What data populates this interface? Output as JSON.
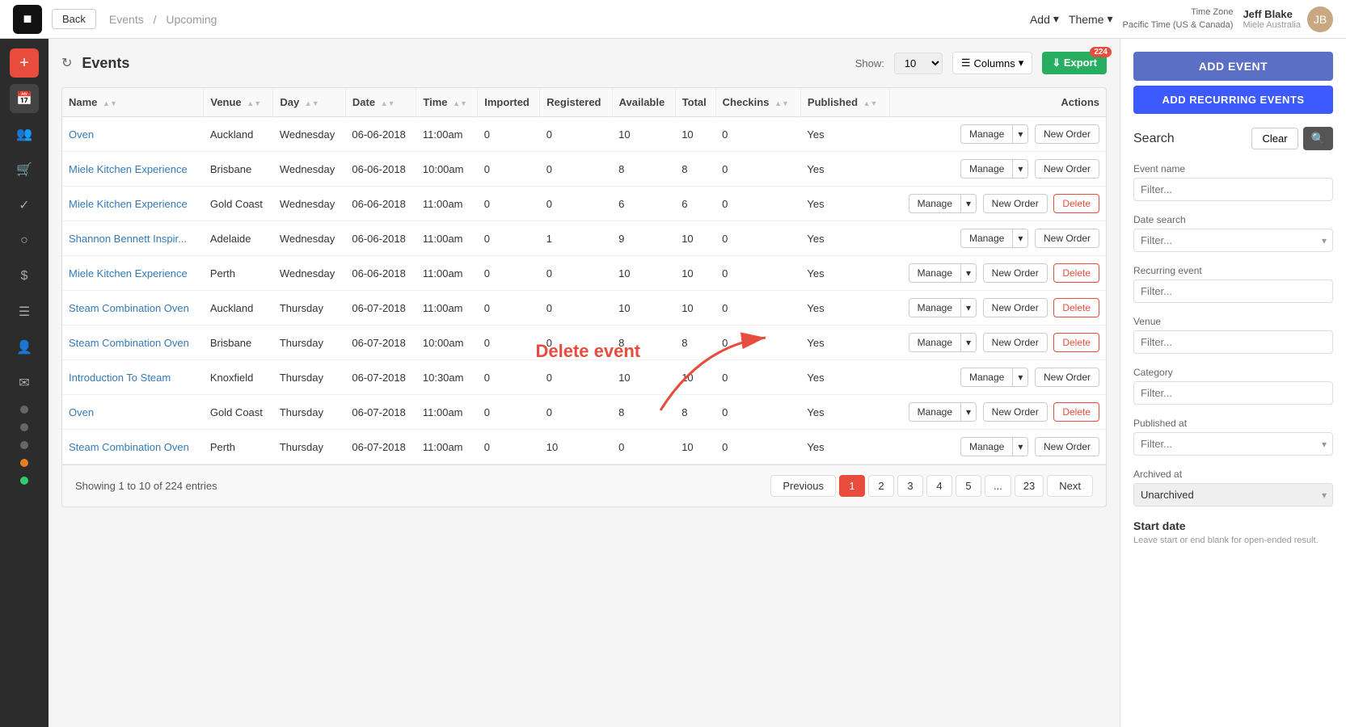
{
  "topnav": {
    "back_label": "Back",
    "breadcrumb_events": "Events",
    "breadcrumb_sep": "/",
    "breadcrumb_upcoming": "Upcoming",
    "add_label": "Add",
    "theme_label": "Theme",
    "timezone_line1": "Time Zone",
    "timezone_line2": "Pacific Time (US & Canada)",
    "user_name": "Jeff Blake",
    "user_company": "Miele Australia"
  },
  "sidebar_right": {
    "add_event_label": "ADD EVENT",
    "add_recurring_label": "ADD RECURRING EVENTS",
    "search_label": "Search",
    "clear_label": "Clear",
    "event_name_label": "Event name",
    "event_name_placeholder": "Filter...",
    "date_search_label": "Date search",
    "date_search_placeholder": "Filter...",
    "recurring_event_label": "Recurring event",
    "recurring_event_placeholder": "Filter...",
    "venue_label": "Venue",
    "venue_placeholder": "Filter...",
    "category_label": "Category",
    "category_placeholder": "Filter...",
    "published_at_label": "Published at",
    "published_at_placeholder": "Filter...",
    "archived_at_label": "Archived at",
    "archived_at_value": "Unarchived",
    "start_date_label": "Start date",
    "start_date_note": "Leave start or end blank for open-ended result."
  },
  "table": {
    "title": "Events",
    "show_label": "Show:",
    "show_value": "10",
    "columns_label": "Columns",
    "export_label": "Export",
    "export_badge": "224",
    "columns": [
      "Name",
      "Venue",
      "Day",
      "Date",
      "Time",
      "Imported",
      "Registered",
      "Available",
      "Total",
      "Checkins",
      "Published",
      "Actions"
    ],
    "rows": [
      {
        "name": "Oven",
        "venue": "Auckland",
        "day": "Wednesday",
        "date": "06-06-2018",
        "time": "11:00am",
        "imported": "0",
        "registered": "0",
        "available": "10",
        "total": "10",
        "checkins": "0",
        "published": "Yes",
        "has_delete": false
      },
      {
        "name": "Miele Kitchen Experience",
        "venue": "Brisbane",
        "day": "Wednesday",
        "date": "06-06-2018",
        "time": "10:00am",
        "imported": "0",
        "registered": "0",
        "available": "8",
        "total": "8",
        "checkins": "0",
        "published": "Yes",
        "has_delete": false
      },
      {
        "name": "Miele Kitchen Experience",
        "venue": "Gold Coast",
        "day": "Wednesday",
        "date": "06-06-2018",
        "time": "11:00am",
        "imported": "0",
        "registered": "0",
        "available": "6",
        "total": "6",
        "checkins": "0",
        "published": "Yes",
        "has_delete": true
      },
      {
        "name": "Shannon Bennett Inspir...",
        "venue": "Adelaide",
        "day": "Wednesday",
        "date": "06-06-2018",
        "time": "11:00am",
        "imported": "0",
        "registered": "1",
        "available": "9",
        "total": "10",
        "checkins": "0",
        "published": "Yes",
        "has_delete": false
      },
      {
        "name": "Miele Kitchen Experience",
        "venue": "Perth",
        "day": "Wednesday",
        "date": "06-06-2018",
        "time": "11:00am",
        "imported": "0",
        "registered": "0",
        "available": "10",
        "total": "10",
        "checkins": "0",
        "published": "Yes",
        "has_delete": true
      },
      {
        "name": "Steam Combination Oven",
        "venue": "Auckland",
        "day": "Thursday",
        "date": "06-07-2018",
        "time": "11:00am",
        "imported": "0",
        "registered": "0",
        "available": "10",
        "total": "10",
        "checkins": "0",
        "published": "Yes",
        "has_delete": true
      },
      {
        "name": "Steam Combination Oven",
        "venue": "Brisbane",
        "day": "Thursday",
        "date": "06-07-2018",
        "time": "10:00am",
        "imported": "0",
        "registered": "0",
        "available": "8",
        "total": "8",
        "checkins": "0",
        "published": "Yes",
        "has_delete": true
      },
      {
        "name": "Introduction To Steam",
        "venue": "Knoxfield",
        "day": "Thursday",
        "date": "06-07-2018",
        "time": "10:30am",
        "imported": "0",
        "registered": "0",
        "available": "10",
        "total": "10",
        "checkins": "0",
        "published": "Yes",
        "has_delete": false
      },
      {
        "name": "Oven",
        "venue": "Gold Coast",
        "day": "Thursday",
        "date": "06-07-2018",
        "time": "11:00am",
        "imported": "0",
        "registered": "0",
        "available": "8",
        "total": "8",
        "checkins": "0",
        "published": "Yes",
        "has_delete": true
      },
      {
        "name": "Steam Combination Oven",
        "venue": "Perth",
        "day": "Thursday",
        "date": "06-07-2018",
        "time": "11:00am",
        "imported": "0",
        "registered": "10",
        "available": "0",
        "total": "10",
        "checkins": "0",
        "published": "Yes",
        "has_delete": false
      }
    ],
    "footer_showing": "Showing 1 to 10 of 224 entries",
    "pagination": {
      "previous_label": "Previous",
      "next_label": "Next",
      "pages": [
        "1",
        "2",
        "3",
        "4",
        "5",
        "...",
        "23"
      ],
      "active_page": "1"
    },
    "annotation": {
      "delete_label": "Delete event"
    }
  }
}
